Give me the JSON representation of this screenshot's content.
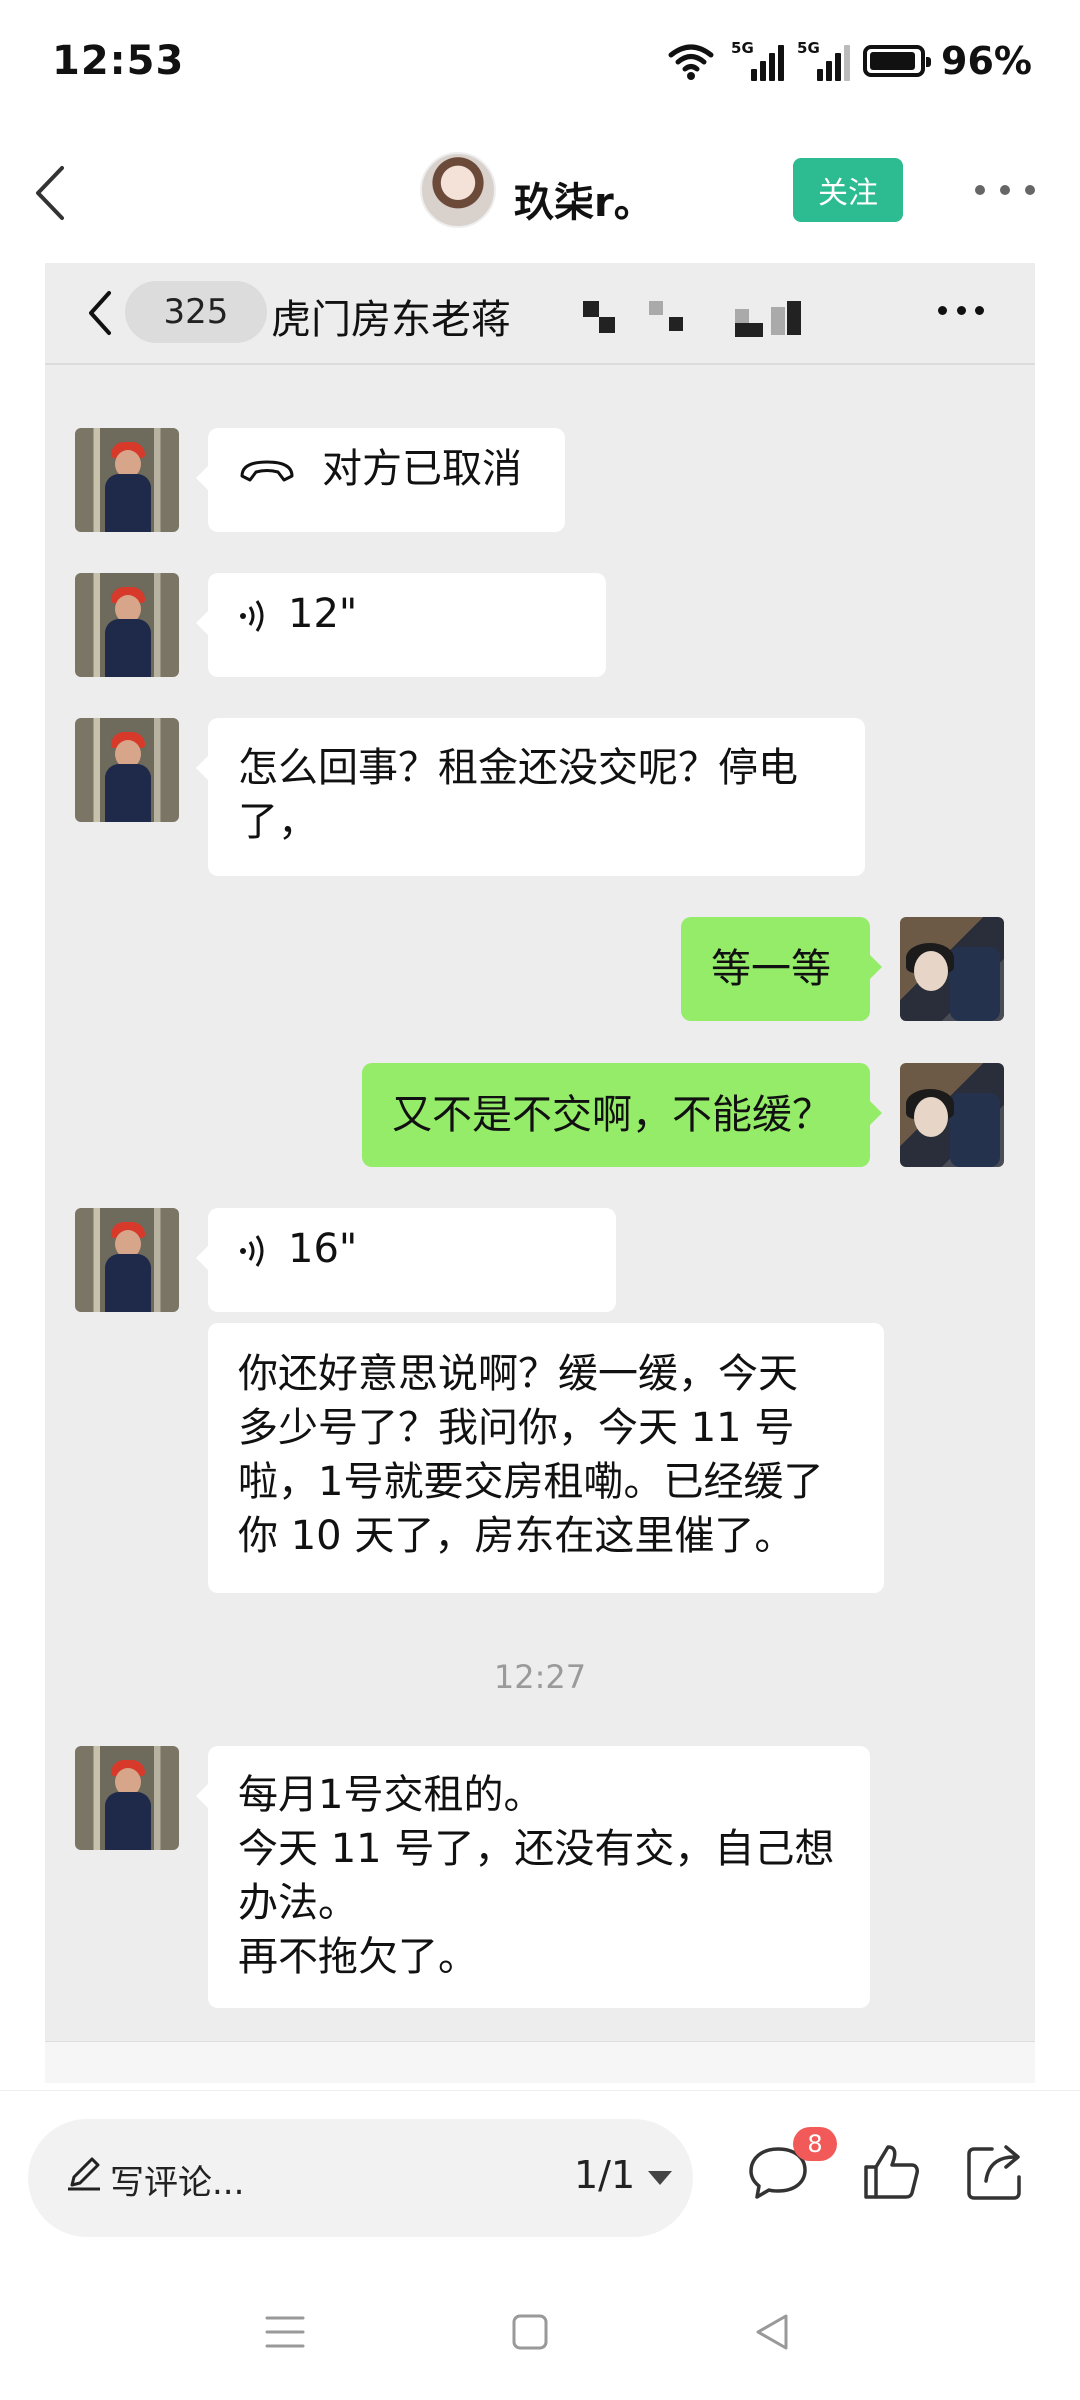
{
  "status_bar": {
    "time": "12:53",
    "network_1": "5G",
    "network_2": "5G",
    "battery": "96%"
  },
  "post_header": {
    "author_name": "玖柒r。",
    "follow_label": "关注"
  },
  "chat_screenshot": {
    "unread_count": "325",
    "title": "虎门房东老蒋",
    "timestamp": "12:27",
    "messages": [
      {
        "side": "left",
        "type": "call",
        "text": "对方已取消"
      },
      {
        "side": "left",
        "type": "voice",
        "text": "12\""
      },
      {
        "side": "left",
        "type": "text",
        "lines": [
          "怎么回事？租金还没交呢？停电",
          "了，"
        ]
      },
      {
        "side": "right",
        "type": "text",
        "lines": [
          "等一等"
        ]
      },
      {
        "side": "right",
        "type": "text",
        "lines": [
          "又不是不交啊，不能缓？"
        ]
      },
      {
        "side": "left",
        "type": "voice",
        "text": "16\""
      },
      {
        "side": "left",
        "type": "text",
        "lines": [
          "你还好意思说啊？缓一缓，今天",
          "多少号了？我问你，今天 11 号",
          "啦，1号就要交房租嘞。已经缓了",
          "你 10 天了，房东在这里催了。"
        ]
      },
      {
        "side": "left",
        "type": "text",
        "lines": [
          "每月1号交租的。",
          "今天 11 号了，还没有交，自己想",
          "办法。",
          "再不拖欠了。"
        ]
      }
    ]
  },
  "bottom_bar": {
    "comment_placeholder": "写评论...",
    "page_indicator": "1/1",
    "comment_badge": "8"
  },
  "colors": {
    "follow": "#2dbc92",
    "bubble_self": "#95ec69",
    "bubble_other": "#ffffff",
    "chat_bg": "#ededed",
    "badge": "#f25a5a"
  },
  "icons": [
    "wifi-icon",
    "signal-icon",
    "battery-icon",
    "back-icon",
    "more-icon",
    "call-icon",
    "voice-icon",
    "pen-icon",
    "comment-icon",
    "like-icon",
    "share-icon",
    "menu-icon",
    "home-icon",
    "nav-back-icon"
  ]
}
